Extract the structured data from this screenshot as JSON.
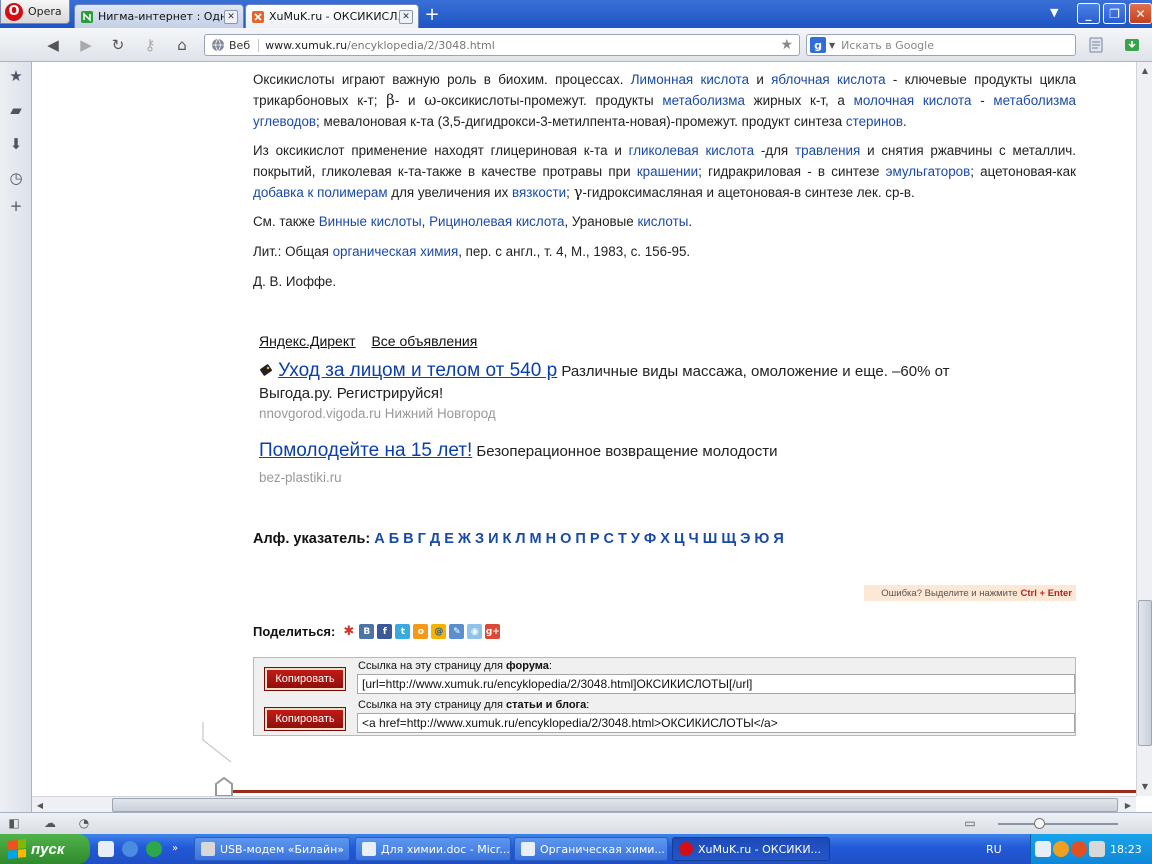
{
  "browser": {
    "menu_label": "Opera",
    "tabs": [
      {
        "title": "Нигма-интернет : Одно..."
      },
      {
        "title": "XuMuK.ru - ОКСИКИСЛ..."
      }
    ],
    "address_prefix": "Веб",
    "url_domain": "www.xumuk.ru",
    "url_path": "/encyklopedia/2/3048.html",
    "search_placeholder": "Искать в Google",
    "search_engine_icon": "google-icon"
  },
  "article": {
    "p1": [
      {
        "t": "Оксикислоты играют важную роль в биохим. процессах. "
      },
      {
        "t": "Лимонная кислота",
        "link": true
      },
      {
        "t": " и "
      },
      {
        "t": "яблочная кислота",
        "link": true
      },
      {
        "t": " - ключевые продукты цикла трикарбоновых к-т; "
      },
      {
        "t": "β",
        "greek": true
      },
      {
        "t": "- и "
      },
      {
        "t": "ω",
        "greek": true
      },
      {
        "t": "-оксикислоты-промежут. продукты "
      },
      {
        "t": "метаболизма",
        "link": true
      },
      {
        "t": " жирных к-т, а "
      },
      {
        "t": "молочная кислота",
        "link": true
      },
      {
        "t": " - "
      },
      {
        "t": "метаболизма углеводов",
        "link": true
      },
      {
        "t": "; мевалоновая к-та (3,5-дигидрокси-3-метилпента-новая)-промежут. продукт синтеза "
      },
      {
        "t": "стеринов",
        "link": true
      },
      {
        "t": "."
      }
    ],
    "p2": [
      {
        "t": "Из оксикислот применение находят глицериновая к-та и "
      },
      {
        "t": "гликолевая кислота",
        "link": true
      },
      {
        "t": " -для "
      },
      {
        "t": "травления",
        "link": true
      },
      {
        "t": " и снятия ржавчины с металлич. покрытий, гликолевая к-та-также в качестве протравы при "
      },
      {
        "t": "крашении",
        "link": true
      },
      {
        "t": "; гидракриловая - в синтезе "
      },
      {
        "t": "эмульгаторов",
        "link": true
      },
      {
        "t": "; ацетоновая-как "
      },
      {
        "t": "добавка к полимерам",
        "link": true
      },
      {
        "t": " для увеличения их "
      },
      {
        "t": "вязкости",
        "link": true
      },
      {
        "t": "; "
      },
      {
        "t": "γ",
        "greek": true
      },
      {
        "t": "-гидроксимасляная и ацетоновая-в синтезе лек. ср-в."
      }
    ],
    "p3": [
      {
        "t": "См. также "
      },
      {
        "t": "Винные кислоты",
        "link": true
      },
      {
        "t": ", "
      },
      {
        "t": "Рицинолевая кислота",
        "link": true
      },
      {
        "t": ", Урановые "
      },
      {
        "t": "кислоты",
        "link": true
      },
      {
        "t": "."
      }
    ],
    "p4": [
      {
        "t": "Лит.: Общая "
      },
      {
        "t": "органическая химия",
        "link": true
      },
      {
        "t": ", пер. с англ., т. 4, М., 1983, с. 156-95."
      }
    ],
    "author": "Д. В. Иоффе."
  },
  "ads": {
    "header_left": "Яндекс.Директ",
    "header_right": "Все объявления",
    "ad1_title": "Уход за лицом и телом от 540 р",
    "ad1_text": " Различные виды массажа, омоложение и еще. –60% от Выгода.ру. Регистрируйся!",
    "ad1_url": "nnovgorod.vigoda.ru Нижний Новгород",
    "ad2_title": "Помолодейте на 15 лет!",
    "ad2_text": " Безоперационное возвращение молодости",
    "ad2_url": "bez-plastiki.ru"
  },
  "alphabet": {
    "label": "Алф. указатель:",
    "letters": [
      "А",
      "Б",
      "В",
      "Г",
      "Д",
      "Е",
      "Ж",
      "З",
      "И",
      "К",
      "Л",
      "М",
      "Н",
      "О",
      "П",
      "Р",
      "С",
      "Т",
      "У",
      "Ф",
      "Х",
      "Ц",
      "Ч",
      "Ш",
      "Щ",
      "Э",
      "Ю",
      "Я"
    ]
  },
  "error_notice": {
    "text": "Ошибка? Выделите и нажмите",
    "keys": "Ctrl + Enter"
  },
  "share": {
    "label": "Поделиться:"
  },
  "link_box": {
    "copy_label": "Копировать",
    "forum_label_prefix": "Ссылка на эту страницу для ",
    "forum_label_bold": "форума",
    "forum_label_suffix": ":",
    "forum_code": "[url=http://www.xumuk.ru/encyklopedia/2/3048.html]ОКСИКИСЛОТЫ[/url]",
    "blog_label_prefix": "Ссылка на эту страницу для ",
    "blog_label_bold": "статьи и блога",
    "blog_label_suffix": ":",
    "blog_code": "<a href=http://www.xumuk.ru/encyklopedia/2/3048.html>ОКСИКИСЛОТЫ</a>"
  },
  "taskbar": {
    "start_label": "пуск",
    "tasks": [
      {
        "label": "USB-модем «Билайн»"
      },
      {
        "label": "Для химии.doc - Micr..."
      },
      {
        "label": "Органическая хими..."
      },
      {
        "label": "XuMuK.ru - ОКСИКИ..."
      }
    ],
    "lang": "RU",
    "clock": "18:23"
  },
  "colors": {
    "link": "#1a4aa8",
    "ad_link": "#0b3fae",
    "copy_button": "#b3140f",
    "taskbar": "#2259d8",
    "start": "#3a9a35"
  }
}
